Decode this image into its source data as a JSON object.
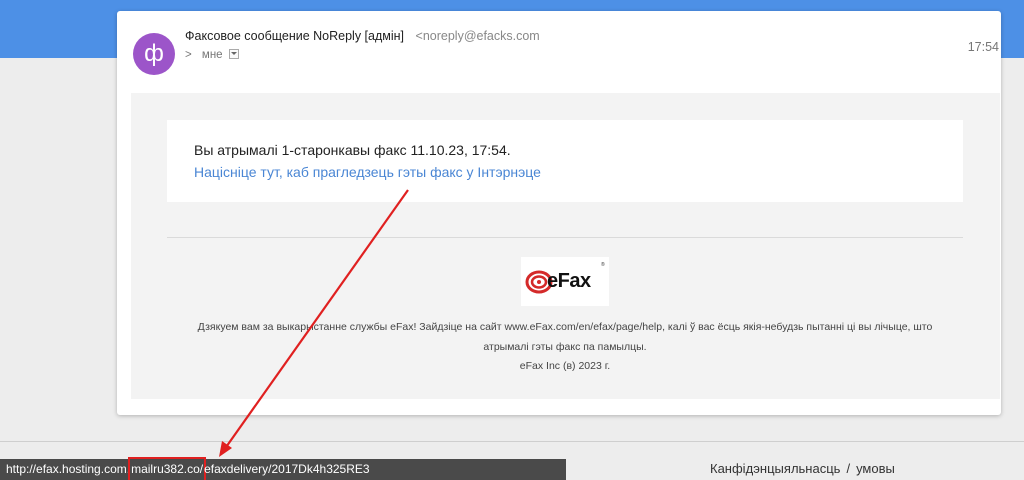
{
  "email": {
    "avatar_letter": "ф",
    "sender_name": "Факсовое сообщение NoReply [адмін]",
    "sender_email": "<noreply@efacks.com",
    "to_chevron": ">",
    "to_label": "мне",
    "time": "17:54"
  },
  "body": {
    "message": "Вы атрымалі 1-старонкавы факс 11.10.23, 17:54.",
    "link_text": "Націсніце тут, каб прагледзець гэты факс у Інтэрнэце",
    "logo_text": "eFax",
    "logo_reg": "®",
    "footer_line1": "Дзякуем вам за выкарыстанне службы eFax! Зайдзіце на сайт www.eFax.com/en/efax/page/help, калі ў вас ёсць якія-небудзь пытанні ці вы лічыце, што",
    "footer_line2": "атрымалі гэты факс па памылцы.",
    "footer_line3": "eFax Inc (в) 2023 г."
  },
  "status_bar": {
    "url_prefix": "http://efax.hosting.com.",
    "url_highlight": "mailru382.co/",
    "url_suffix": "efaxdelivery/2017Dk4h325RE3"
  },
  "footer_links": {
    "privacy": "Канфідэнцыяльнасць",
    "separator": "/",
    "terms": "умовы"
  },
  "colors": {
    "header_band": "#4d90e6",
    "avatar": "#9c55c9",
    "link": "#4a86d4",
    "highlight": "#e02020"
  }
}
